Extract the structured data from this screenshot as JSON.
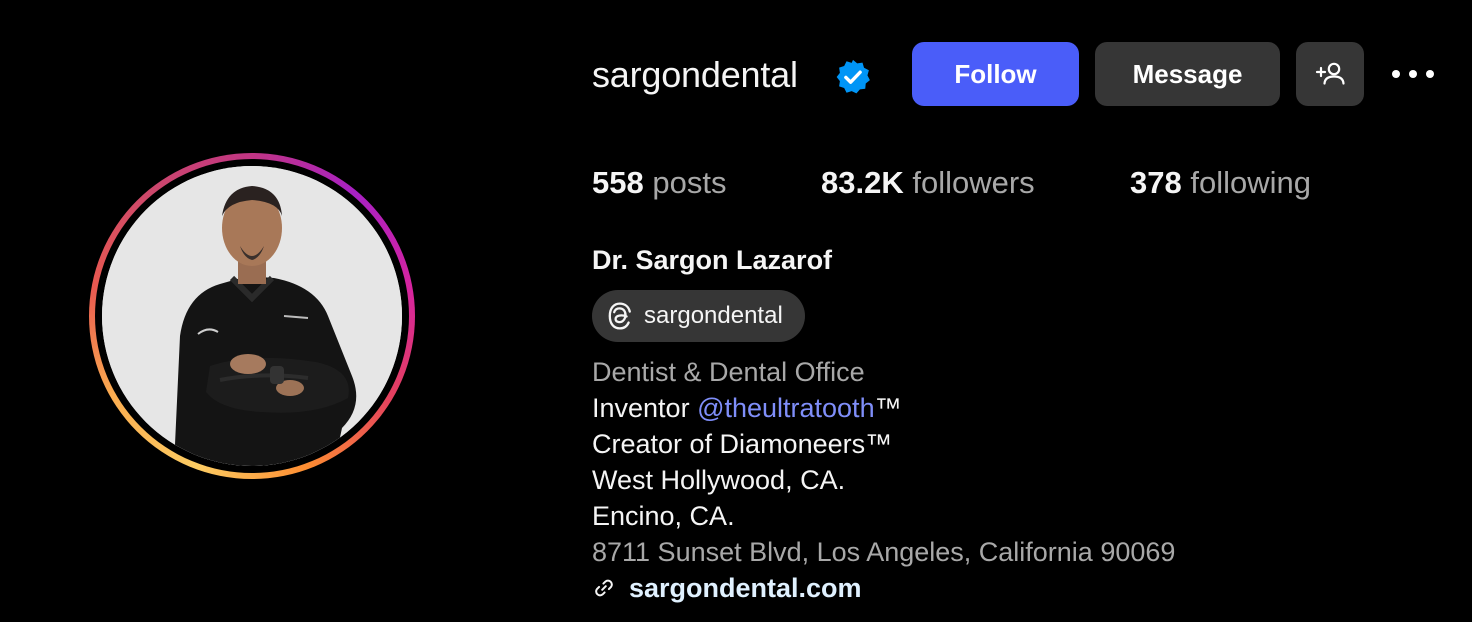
{
  "profile": {
    "username": "sargondental",
    "verified_icon": "verified-badge-icon",
    "colors": {
      "follow_button": "#4a5df9",
      "secondary_button": "#363636",
      "verified_badge": "#0095f6",
      "mention_link": "#7f8ef9",
      "muted_text": "#a8a8a8"
    }
  },
  "actions": {
    "follow_label": "Follow",
    "message_label": "Message",
    "add_user_icon": "add-person-icon",
    "more_icon": "ellipsis-icon"
  },
  "stats": {
    "posts_count": "558",
    "posts_label": "posts",
    "followers_count": "83.2K",
    "followers_label": "followers",
    "following_count": "378",
    "following_label": "following"
  },
  "bio": {
    "full_name": "Dr. Sargon Lazarof",
    "threads_handle": "sargondental",
    "threads_icon": "threads-icon",
    "category": "Dentist & Dental Office",
    "line1_prefix": "Inventor ",
    "line1_mention": "@theultratooth",
    "line1_suffix": "™",
    "line2": "Creator of Diamoneers™",
    "line3": "West Hollywood, CA.",
    "line4": "Encino, CA.",
    "address": "8711 Sunset Blvd, Los Angeles, California 90069",
    "website": "sargondental.com",
    "link_icon": "link-icon"
  }
}
